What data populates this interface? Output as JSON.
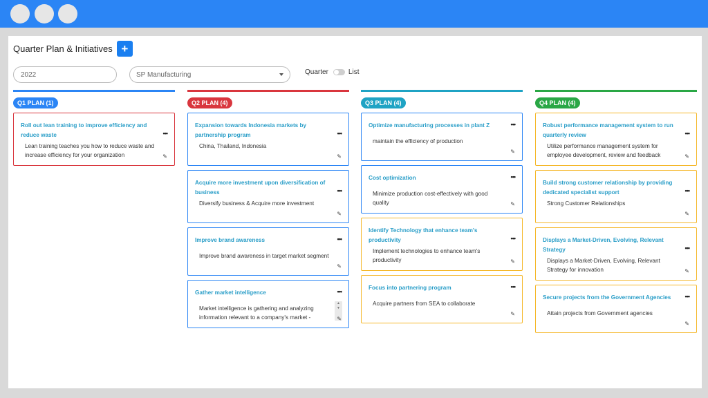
{
  "page": {
    "title": "Quarter Plan & Initiatives",
    "add_icon": "plus-icon",
    "add_glyph": "+"
  },
  "filters": {
    "year": "2022",
    "company": "SP Manufacturing",
    "view_left": "Quarter",
    "view_right": "List",
    "list_mode_on": false
  },
  "colors": {
    "topbar": "#2b85f5",
    "accent": "#1a7ff0",
    "q1": "#2b85f5",
    "q2": "#d9363e",
    "q3": "#1fa3c4",
    "q4": "#2aa745",
    "card_blue": "#2b85f5",
    "card_red": "#d9363e",
    "card_yellow": "#f5b728",
    "title_text": "#2a9ec8"
  },
  "columns": [
    {
      "label": "Q1 PLAN (1)",
      "color": "#2b85f5",
      "cards": [
        {
          "title": "Roll out lean training to improve efficiency and reduce waste",
          "desc": "Lean training teaches you how to reduce waste and increase efficiency for your organization",
          "border": "#d9363e"
        }
      ]
    },
    {
      "label": "Q2 PLAN (4)",
      "color": "#d9363e",
      "cards": [
        {
          "title": "Expansion towards Indonesia markets by partnership program",
          "desc": "China, Thailand, Indonesia",
          "border": "#2b85f5"
        },
        {
          "title": "Acquire more investment upon diversification of business",
          "desc": "Diversify business & Acquire more investment",
          "border": "#2b85f5"
        },
        {
          "title": "Improve brand awareness",
          "desc": "Improve brand awareness in target market segment",
          "border": "#2b85f5"
        },
        {
          "title": "Gather market intelligence",
          "desc": "Market intelligence is gathering and analyzing information relevant to a company's market -",
          "border": "#2b85f5",
          "scroll": true
        }
      ]
    },
    {
      "label": "Q3 PLAN (4)",
      "color": "#1fa3c4",
      "cards": [
        {
          "title": "Optimize manufacturing processes in plant Z",
          "desc": "maintain the efficiency of production",
          "border": "#2b85f5"
        },
        {
          "title": "Cost optimization",
          "desc": "Minimize production cost-effectively with good quality",
          "border": "#2b85f5"
        },
        {
          "title": "Identify Technology that enhance team's productivity",
          "desc": "Implement technologies to enhance team's productivity",
          "border": "#f5b728"
        },
        {
          "title": "Focus into partnering program",
          "desc": "Acquire partners from SEA to collaborate",
          "border": "#f5b728"
        }
      ]
    },
    {
      "label": "Q4 PLAN (4)",
      "color": "#2aa745",
      "cards": [
        {
          "title": "Robust performance management system to run quarterly review",
          "desc": "Utilize performance management system for employee development, review and feedback",
          "border": "#f5b728"
        },
        {
          "title": "Build strong customer relationship by providing dedicated specialist support",
          "desc": "Strong Customer Relationships",
          "border": "#f5b728"
        },
        {
          "title": "Displays a Market-Driven, Evolving, Relevant Strategy",
          "desc": "Displays a Market-Driven, Evolving, Relevant Strategy for innovation",
          "border": "#f5b728"
        },
        {
          "title": "Secure projects from the Government Agencies",
          "desc": "Attain projects from Government agencies",
          "border": "#f5b728"
        }
      ]
    }
  ]
}
